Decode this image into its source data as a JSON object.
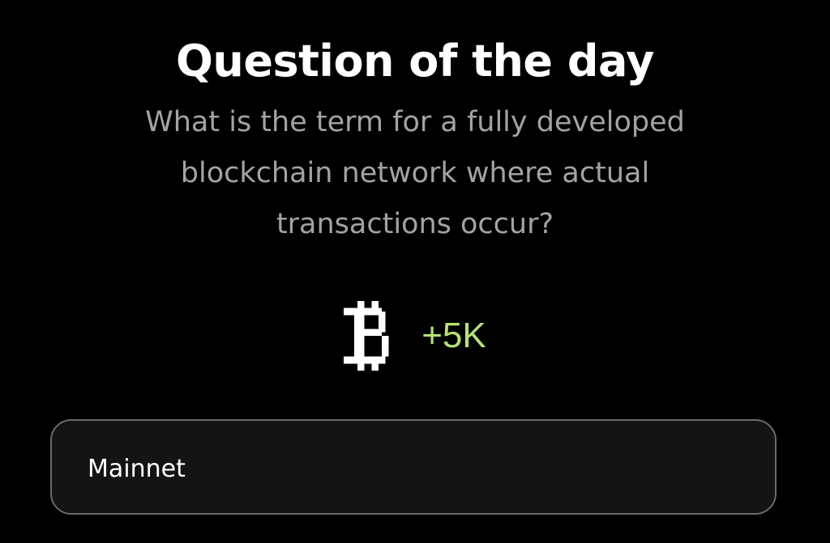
{
  "header": {
    "title": "Question of the day"
  },
  "question": {
    "text": "What is the term for a fully developed blockchain network where actual transactions occur?"
  },
  "reward": {
    "icon": "bitcoin-icon",
    "amount": "+5K",
    "amount_color": "#b4e472"
  },
  "answer": {
    "value": "Mainnet",
    "placeholder": ""
  }
}
